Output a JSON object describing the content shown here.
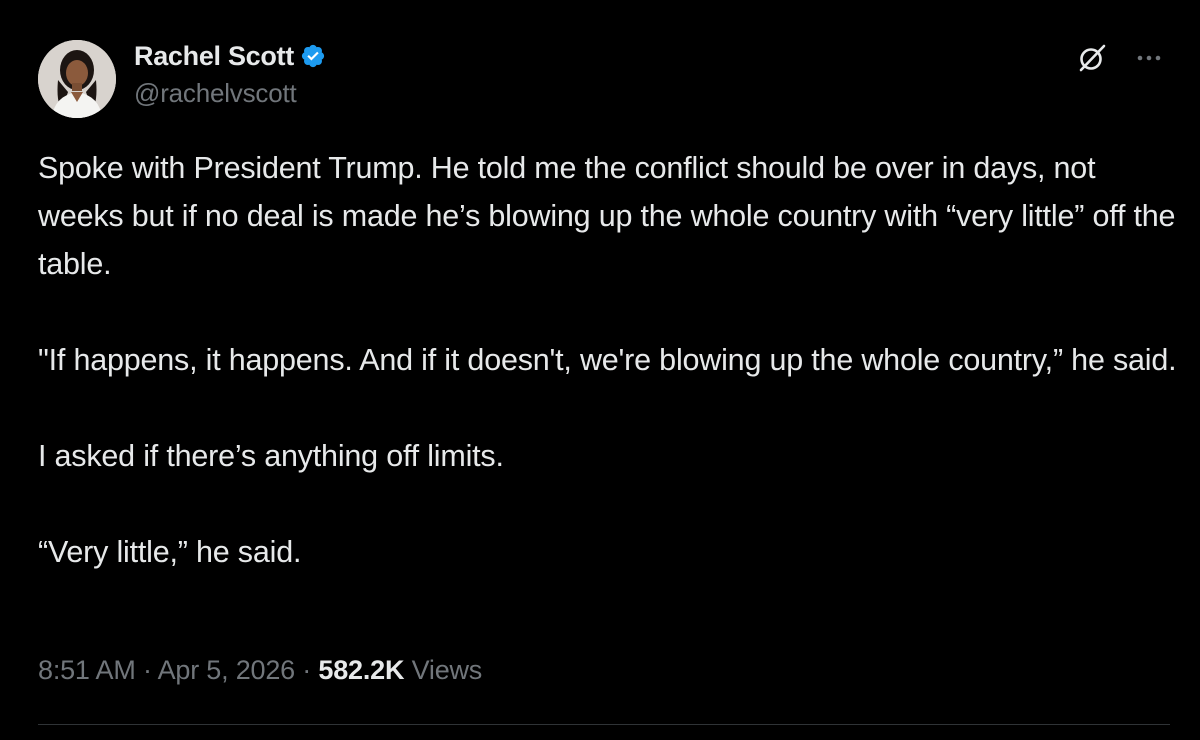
{
  "author": {
    "display_name": "Rachel Scott",
    "handle": "@rachelvscott",
    "verified": true,
    "verified_color": "#1d9bf0"
  },
  "header_icons": {
    "grok": "grok-icon",
    "more": "more-options-icon"
  },
  "tweet": {
    "paragraphs": [
      "Spoke with President Trump. He told me the conflict should be over in days, not weeks but if no deal is made he’s blowing up the whole country with “very little” off the table.",
      "\"If happens, it happens. And if it doesn't, we're blowing up the whole country,” he said.",
      "I asked if there’s anything off limits.",
      "“Very little,” he said."
    ]
  },
  "meta": {
    "time": "8:51 AM",
    "separator": " · ",
    "date": "Apr 5, 2026",
    "views_count": "582.2K",
    "views_label": "Views"
  },
  "colors": {
    "background": "#000000",
    "text_primary": "#e7e9ea",
    "text_secondary": "#71767b",
    "divider": "#2f3336"
  }
}
